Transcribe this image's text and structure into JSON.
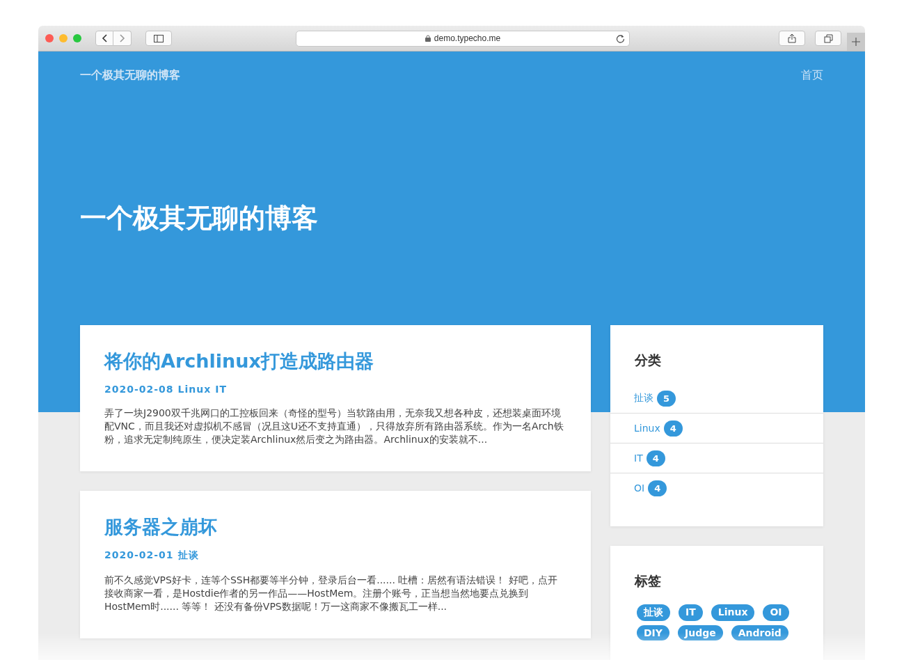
{
  "browser": {
    "url": "demo.typecho.me"
  },
  "site": {
    "brand": "一个极其无聊的博客",
    "nav": [
      {
        "label": "首页"
      }
    ],
    "hero_title": "一个极其无聊的博客"
  },
  "posts": [
    {
      "title": "将你的Archlinux打造成路由器",
      "date": "2020-02-08",
      "categories": [
        "Linux",
        "IT"
      ],
      "excerpt": "弄了一块J2900双千兆网口的工控板回来（奇怪的型号）当软路由用，无奈我又想各种皮，还想装桌面环境配VNC，而且我还对虚拟机不感冒（况且这U还不支持直通），只得放弃所有路由器系统。作为一名Arch铁粉，追求无定制纯原生，便决定装Archlinux然后变之为路由器。Archlinux的安装就不..."
    },
    {
      "title": "服务器之崩坏",
      "date": "2020-02-01",
      "categories": [
        "扯谈"
      ],
      "excerpt": "前不久感觉VPS好卡，连等个SSH都要等半分钟，登录后台一看...... 吐槽：居然有语法错误！ 好吧，点开接收商家一看，是Hostdie作者的另一作品——HostMem。注册个账号，正当想当然地要点兑换到HostMem时...... 等等！ 还没有备份VPS数据呢！万一这商家不像搬瓦工一样..."
    }
  ],
  "sidebar": {
    "categories": {
      "title": "分类",
      "items": [
        {
          "name": "扯谈",
          "count": "5"
        },
        {
          "name": "Linux",
          "count": "4"
        },
        {
          "name": "IT",
          "count": "4"
        },
        {
          "name": "OI",
          "count": "4"
        }
      ]
    },
    "tags": {
      "title": "标签",
      "items": [
        "扯谈",
        "IT",
        "Linux",
        "OI",
        "DIY",
        "Judge",
        "Android"
      ]
    }
  }
}
